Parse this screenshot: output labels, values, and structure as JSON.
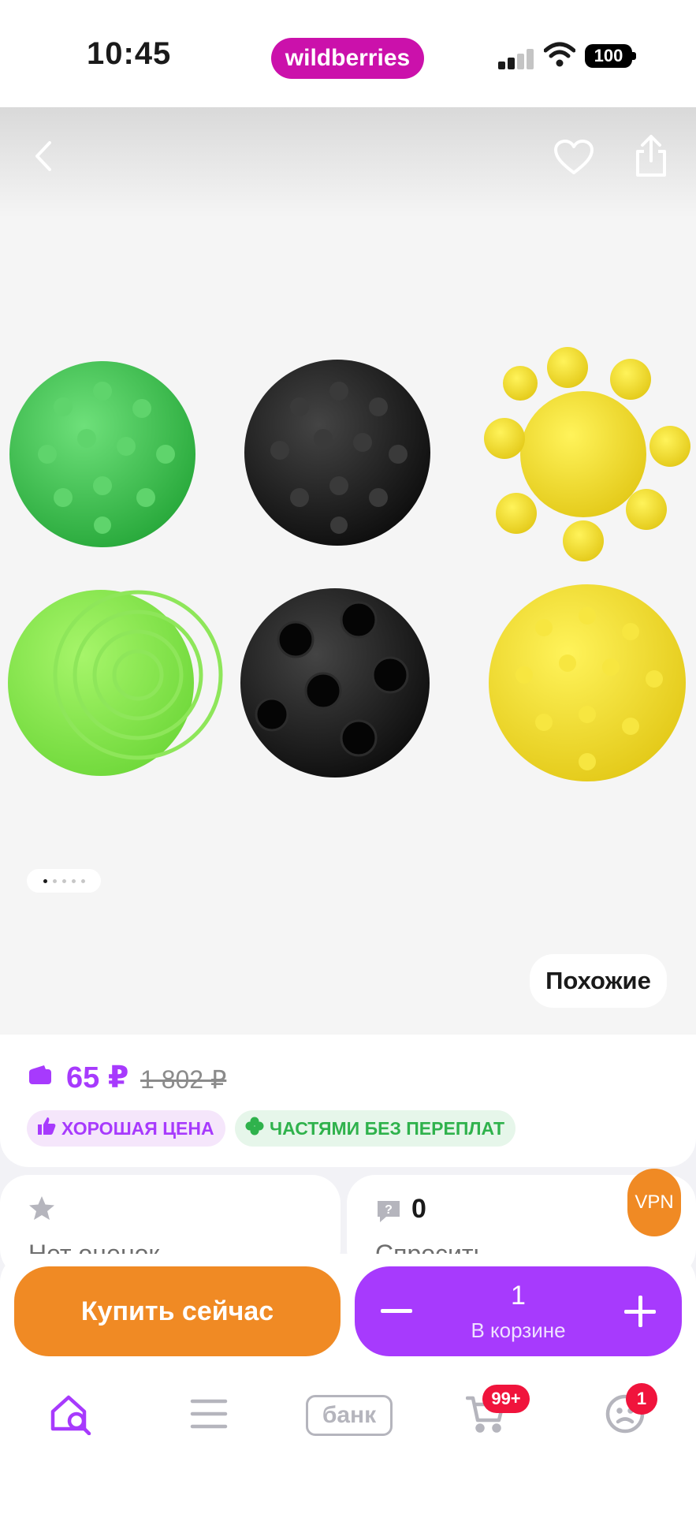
{
  "status_bar": {
    "time": "10:45",
    "app_brand": "wildberries",
    "battery": "100"
  },
  "gallery": {
    "similar_label": "Похожие",
    "dots_count": 5,
    "active_dot": 1
  },
  "product": {
    "price": "65 ₽",
    "old_price": "1 802 ₽",
    "badges": [
      {
        "label": "ХОРОШАЯ ЦЕНА",
        "icon": "thumbs-up-icon"
      },
      {
        "label": "ЧАСТЯМИ БЕЗ ПЕРЕПЛАТ",
        "icon": "clover-icon"
      }
    ]
  },
  "rating": {
    "label": "Нет оценок"
  },
  "questions": {
    "count": "0",
    "label": "Спросить"
  },
  "vpn": {
    "label": "VPN"
  },
  "actions": {
    "buy_label": "Купить сейчас",
    "cart_qty": "1",
    "cart_label": "В корзине"
  },
  "tab_bar": {
    "bank_label": "банк",
    "cart_badge": "99+",
    "profile_badge": "1"
  },
  "colors": {
    "brand": "#cb11ab",
    "accent_purple": "#a73afd",
    "accent_orange": "#f08a24",
    "badge_red": "#f0143c",
    "green": "#2fb24c"
  }
}
